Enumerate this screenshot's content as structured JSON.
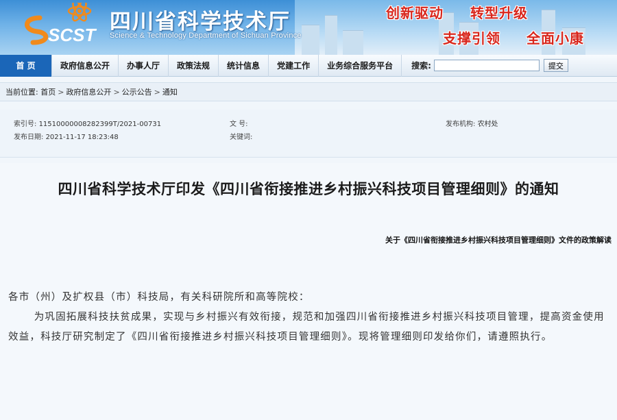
{
  "header": {
    "logo_text": "SCST",
    "title": "四川省科学技术厅",
    "subtitle": "Science & Technology Department of Sichuan Province",
    "slogans": [
      "创新驱动",
      "转型升级",
      "支撑引领",
      "全面小康"
    ]
  },
  "nav": {
    "items": [
      "首 页",
      "政府信息公开",
      "办事人厅",
      "政策法规",
      "统计信息",
      "党建工作",
      "业务综合服务平台"
    ],
    "search_label": "搜索:",
    "search_value": "",
    "search_button": "提交"
  },
  "breadcrumb": {
    "prefix": "当前位置:",
    "items": [
      "首页",
      "政府信息公开",
      "公示公告",
      "通知"
    ]
  },
  "meta": {
    "index_label": "索引号:",
    "index_value": "115100000082823​99T/2021-00731",
    "doc_no_label": "文 号:",
    "doc_no_value": "",
    "issuer_label": "发布机构:",
    "issuer_value": "农村处",
    "date_label": "发布日期:",
    "date_value": "2021-11-17 18:23:48",
    "keywords_label": "关键词:",
    "keywords_value": ""
  },
  "article": {
    "title": "四川省科学技术厅印发《四川省衔接推进乡村振兴科技项目管理细则》的通知",
    "interpretation_link": "关于《四川省衔接推进乡村振兴科技项目管理细则》文件的政策解读",
    "salutation": "各市（州）及扩权县（市）科技局，有关科研院所和高等院校：",
    "paragraph": "为巩固拓展科技扶贫成果，实现与乡村振兴有效衔接，规范和加强四川省衔接推进乡村振兴科技项目管理，提高资金使用效益，科技厅研究制定了《四川省衔接推进乡村振兴科技项目管理细则》。现将管理细则印发给你们，请遵照执行。"
  },
  "colors": {
    "nav_home_bg": "#1b66b8",
    "slogan_red": "#d8261c",
    "banner_blue": "#3d8fd6"
  }
}
